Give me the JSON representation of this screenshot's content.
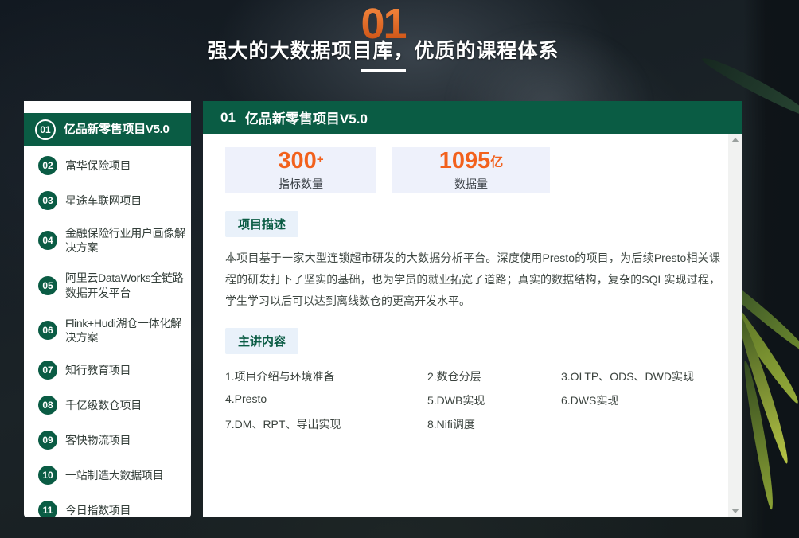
{
  "hero": {
    "number": "01",
    "title": "强大的大数据项目库，优质的课程体系"
  },
  "sidebar": {
    "items": [
      {
        "num": "01",
        "label": "亿品新零售项目V5.0",
        "active": true
      },
      {
        "num": "02",
        "label": "富华保险项目",
        "active": false
      },
      {
        "num": "03",
        "label": "星途车联网项目",
        "active": false
      },
      {
        "num": "04",
        "label": "金融保险行业用户画像解决方案",
        "active": false
      },
      {
        "num": "05",
        "label": "阿里云DataWorks全链路数据开发平台",
        "active": false
      },
      {
        "num": "06",
        "label": "Flink+Hudi湖仓一体化解决方案",
        "active": false
      },
      {
        "num": "07",
        "label": "知行教育项目",
        "active": false
      },
      {
        "num": "08",
        "label": "千亿级数仓项目",
        "active": false
      },
      {
        "num": "09",
        "label": "客快物流项目",
        "active": false
      },
      {
        "num": "10",
        "label": "一站制造大数据项目",
        "active": false
      },
      {
        "num": "11",
        "label": "今日指数项目",
        "active": false
      }
    ]
  },
  "panel": {
    "header": {
      "number": "01",
      "title": "亿品新零售项目V5.0"
    },
    "stats": [
      {
        "value": "300",
        "suffix": "+",
        "label": "指标数量"
      },
      {
        "value": "1095",
        "suffix": "亿",
        "label": "数据量"
      }
    ],
    "description": {
      "heading": "项目描述",
      "body": "本项目基于一家大型连锁超市研发的大数据分析平台。深度使用Presto的项目，为后续Presto相关课程的研发打下了坚实的基础，也为学员的就业拓宽了道路；真实的数据结构，复杂的SQL实现过程，学生学习以后可以达到离线数仓的更高开发水平。"
    },
    "topics": {
      "heading": "主讲内容",
      "items": [
        "1.项目介绍与环境准备",
        "2.数仓分层",
        "3.OLTP、ODS、DWD实现",
        "4.Presto",
        "5.DWB实现",
        "6.DWS实现",
        "7.DM、RPT、导出实现",
        "8.Nifi调度"
      ]
    }
  },
  "colors": {
    "brand_green": "#0a5c44",
    "accent_orange": "#f2611d",
    "stat_box_bg": "#eef1fb",
    "section_label_bg": "#e9f1fa",
    "panel_bg": "#ffffff"
  }
}
